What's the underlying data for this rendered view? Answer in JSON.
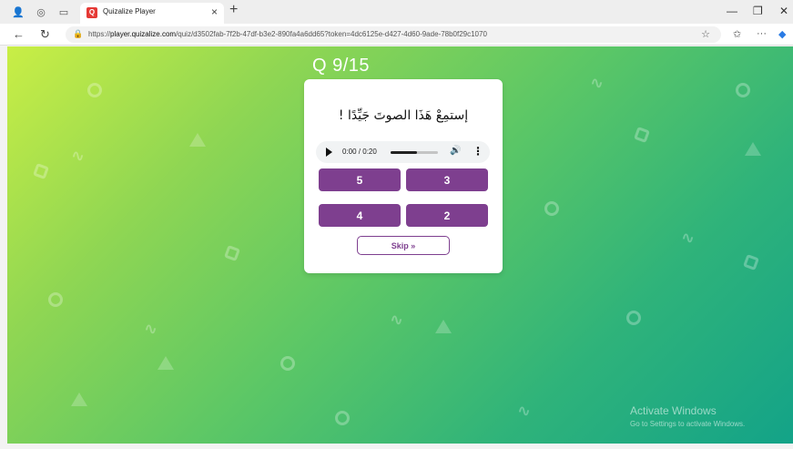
{
  "browser": {
    "tab_title": "Quizalize Player",
    "tab_favicon": "Q",
    "tab_close": "×",
    "new_tab": "+",
    "url_prefix": "https://",
    "url_host": "player.quizalize.com",
    "url_path": "/quiz/d3502fab-7f2b-47df-b3e2-890fa4a6dd65?token=4dc6125e-d427-4d60-9ade-78b0f29c1070",
    "window_minimize": "—",
    "window_restore": "❐",
    "window_close": "✕"
  },
  "quiz": {
    "question_counter": "Q 9/15",
    "question_text": "إستمِعْ هَذَا الصوتَ جَيِّدًا !",
    "audio": {
      "time": "0:00 / 0:20",
      "progress": 0.55
    },
    "options": [
      "5",
      "3",
      "4",
      "2"
    ],
    "skip_label": "Skip »"
  },
  "watermark": {
    "title": "Activate Windows",
    "subtitle": "Go to Settings to activate Windows."
  },
  "colors": {
    "accent": "#7e3f8f",
    "gradient_start": "#c9ee45",
    "gradient_end": "#13a388"
  }
}
